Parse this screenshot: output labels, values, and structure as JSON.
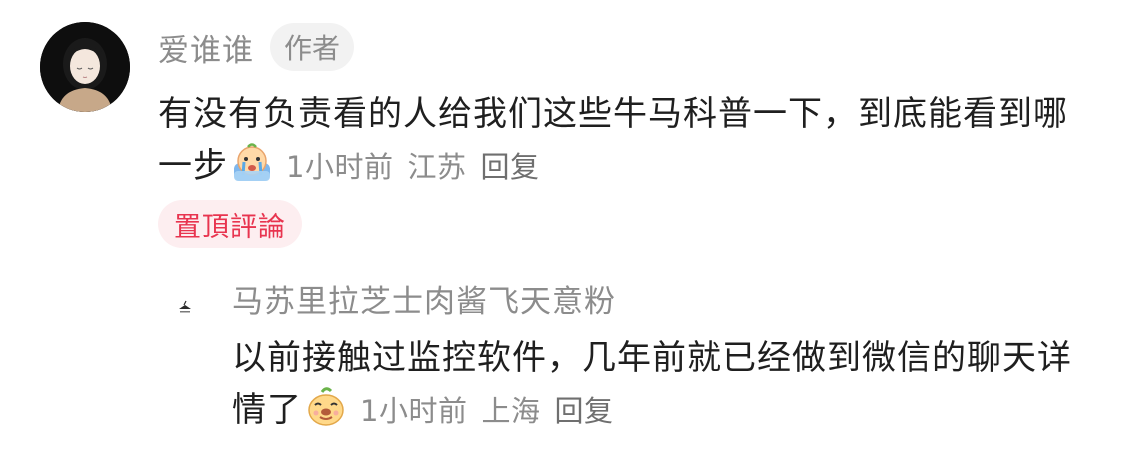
{
  "comment": {
    "username": "爱谁谁",
    "author_badge": "作者",
    "text": "有没有负责看的人给我们这些牛马科普一下，到底能看到哪一步",
    "time": "1小时前",
    "location": "江苏",
    "reply_label": "回复",
    "pinned_label": "置頂評論",
    "emoji_icon": "crying-face-emoji"
  },
  "reply": {
    "username": "马苏里拉芝士肉酱飞天意粉",
    "text": "以前接触过监控软件，几年前就已经做到微信的聊天详情了",
    "time": "1小时前",
    "location": "上海",
    "reply_label": "回复",
    "emoji_icon": "smirk-face-emoji"
  },
  "colors": {
    "secondary_text": "#8c8c8c",
    "primary_text": "#1f1f1f",
    "pinned_text": "#e8344f",
    "pinned_bg": "#fdeef0",
    "badge_bg": "#f2f2f2"
  }
}
